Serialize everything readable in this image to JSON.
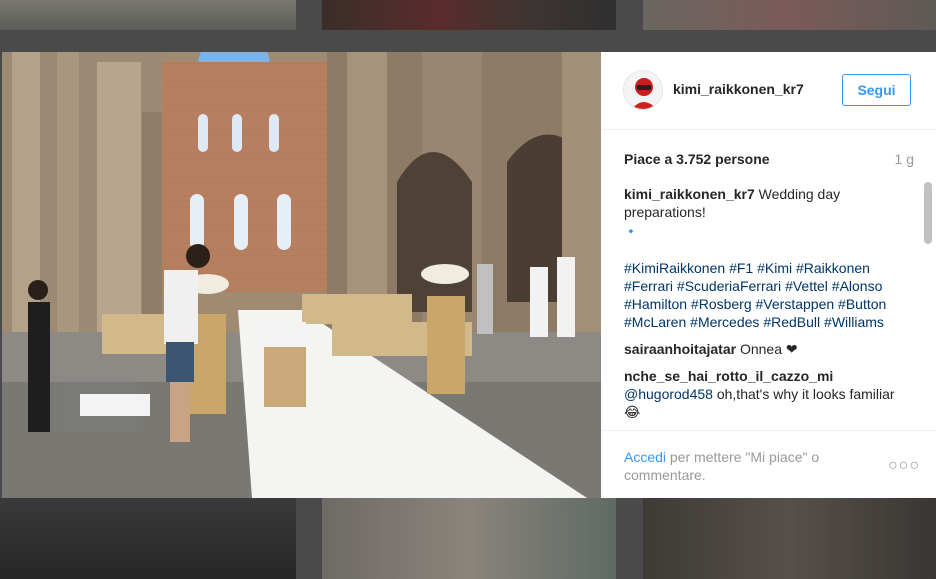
{
  "post": {
    "username": "kimi_raikkonen_kr7",
    "follow_label": "Segui",
    "likes": "Piace a 3.752 persone",
    "age": "1 g",
    "caption_text": "Wedding day preparations!",
    "diamond": "🔹",
    "hashtags": [
      "#KimiRaikkonen",
      "#F1",
      "#Kimi",
      "#Raikkonen",
      "#Ferrari",
      "#ScuderiaFerrari",
      "#Vettel",
      "#Alonso",
      "#Hamilton",
      "#Rosberg",
      "#Verstappen",
      "#Button",
      "#McLaren",
      "#Mercedes",
      "#RedBull",
      "#Williams"
    ]
  },
  "comments": [
    {
      "user": "sairaanhoitajatar",
      "text": "Onnea ❤"
    },
    {
      "user": "nche_se_hai_rotto_il_cazzo_mi",
      "mention": "@hugorod458",
      "text": "oh,that's why it looks familiar 😂"
    }
  ],
  "footer": {
    "login_link": "Accedi",
    "login_text": " per mettere \"Mi piace\" o commentare.",
    "more_icon": "ellipsis-icon"
  },
  "colors": {
    "link_blue": "#3897f0",
    "hashtag": "#003569",
    "text": "#262626",
    "muted": "#999999"
  }
}
